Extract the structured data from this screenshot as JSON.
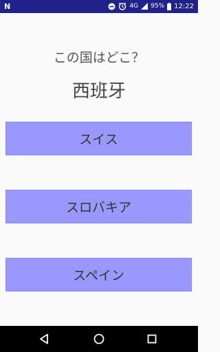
{
  "status_bar": {
    "app_icon_label": "N",
    "network_label": "4G",
    "battery_percent": "95%",
    "time": "12:22"
  },
  "quiz": {
    "question": "この国はどこ？",
    "country": "西班牙",
    "answers": [
      "スイス",
      "スロバキア",
      "スペイン"
    ]
  },
  "colors": {
    "status_bar": "#1e228a",
    "answer_button": "#9898ff",
    "background": "#fafafa",
    "nav_bar": "#000000"
  },
  "icons": {
    "status": [
      "notification-n-icon",
      "dnd-icon",
      "alarm-icon",
      "signal-icon",
      "battery-icon"
    ],
    "nav": [
      "back-icon",
      "home-icon",
      "recents-icon"
    ]
  }
}
